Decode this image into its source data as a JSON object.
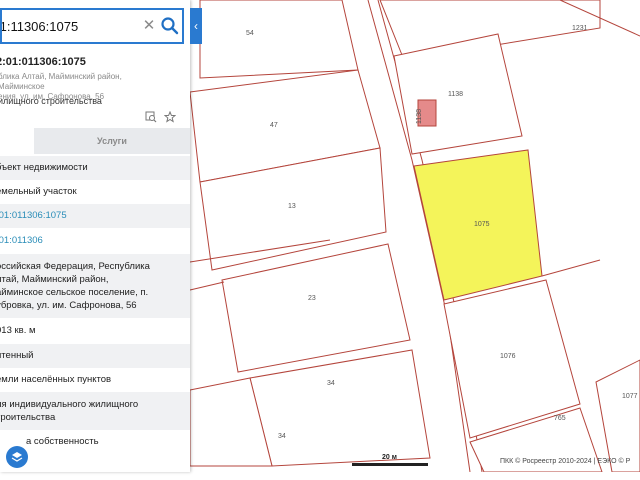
{
  "search": {
    "value": ":1:11306:1075"
  },
  "plot": {
    "number": "2:01:011306:1075",
    "address_short": "блика Алтай, Майминский район, Майминское\nения, ул. им. Сафронова, 56",
    "purpose_short": "илищного строительства"
  },
  "tabs": {
    "services": "Услуги"
  },
  "rows": {
    "type": "бъект недвижимости",
    "kind": "емельный участок",
    "cad": ":01:011306:1075",
    "quarter": ":01:011306",
    "address": [
      "оссийская Федерация, Республика",
      "лтай, Майминский район,",
      "айминское сельское поселение, п.",
      "убровка, ул. им. Сафронова, 56"
    ],
    "area": "013 кв. м",
    "status": "итенный",
    "category": "емли населённых пунктов",
    "use": [
      "ля индивидуального жилищного",
      "троительства"
    ],
    "ownership": "а собственность"
  },
  "map": {
    "plot_labels": [
      "54",
      "1231",
      "1138",
      "47",
      "1075",
      "13",
      "23",
      "1076",
      "34",
      "34",
      "765",
      "1077"
    ],
    "building_label": "1138",
    "scale": "20 м",
    "copyright": "ПКК © Росреестр 2010-2024 | ЕЭКО © Р"
  },
  "colors": {
    "accent": "#2a7ad0",
    "boundary": "#b4453c",
    "selected": "#f4f45a",
    "link": "#2a8db8"
  }
}
